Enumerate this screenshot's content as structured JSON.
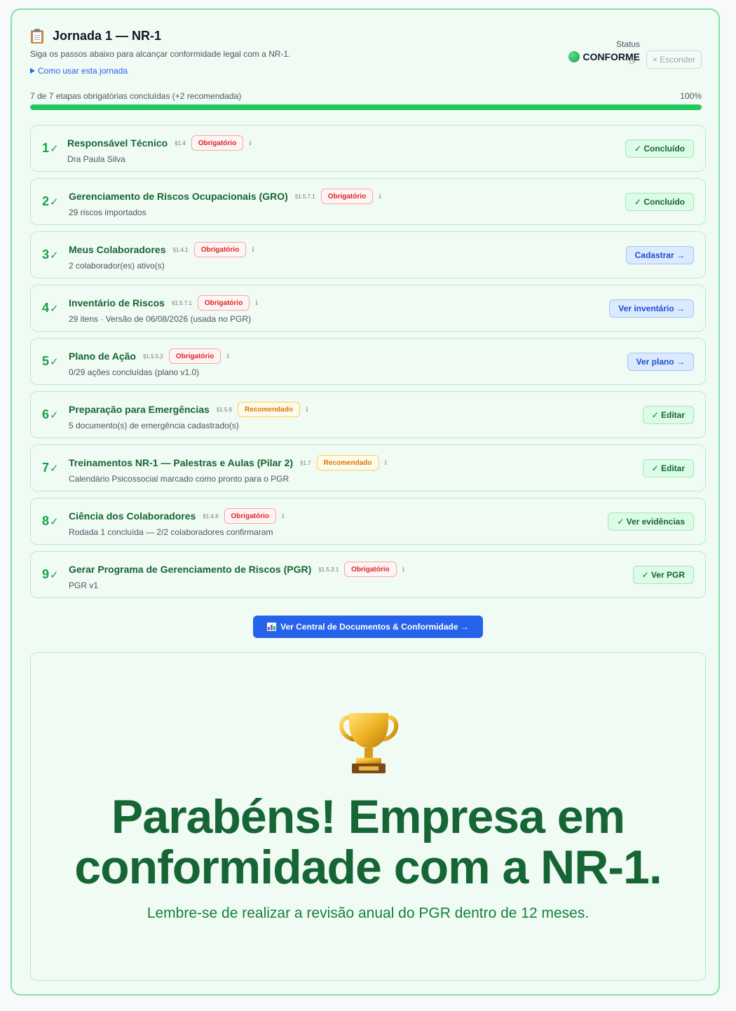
{
  "header": {
    "icon": "clipboard-icon",
    "title": "Jornada 1 — NR-1",
    "subtitle": "Siga os passos abaixo para alcançar conformidade legal com a NR-1.",
    "howto_label": "Como usar esta jornada",
    "status_label": "Status",
    "status_value": "CONFORME",
    "status_color": "#1a9c49",
    "refresh_icon": "refresh-icon",
    "hide_label": "× Esconder"
  },
  "progress": {
    "text": "7 de 7 etapas obrigatórias concluídas (+2 recomendada)",
    "percent_label": "100%",
    "percent": 100
  },
  "steps": [
    {
      "num": "1",
      "name": "Responsável Técnico",
      "section": "§1.4",
      "tag": "Obrigatório",
      "tag_type": "req",
      "desc": "Dra Paula Silva",
      "action": "✓ Concluído",
      "action_type": "done"
    },
    {
      "num": "2",
      "name": "Gerenciamento de Riscos Ocupacionais (GRO)",
      "section": "§1.5.7.1",
      "tag": "Obrigatório",
      "tag_type": "req",
      "desc": "29 riscos importados",
      "action": "✓ Concluído",
      "action_type": "done"
    },
    {
      "num": "3",
      "name": "Meus Colaboradores",
      "section": "§1.4.1",
      "tag": "Obrigatório",
      "tag_type": "req",
      "desc": "2 colaborador(es) ativo(s)",
      "action": "Cadastrar →",
      "action_type": "go"
    },
    {
      "num": "4",
      "name": "Inventário de Riscos",
      "section": "§1.5.7.1",
      "tag": "Obrigatório",
      "tag_type": "req",
      "desc": "29 itens · Versão de 06/08/2026 (usada no PGR)",
      "action": "Ver inventário →",
      "action_type": "go"
    },
    {
      "num": "5",
      "name": "Plano de Ação",
      "section": "§1.5.5.2",
      "tag": "Obrigatório",
      "tag_type": "req",
      "desc": "0/29 ações concluídas (plano v1.0)",
      "action": "Ver plano →",
      "action_type": "go"
    },
    {
      "num": "6",
      "name": "Preparação para Emergências",
      "section": "§1.5.6",
      "tag": "Recomendado",
      "tag_type": "rec",
      "desc": "5 documento(s) de emergência cadastrado(s)",
      "action": "✓ Editar",
      "action_type": "done"
    },
    {
      "num": "7",
      "name": "Treinamentos NR-1 — Palestras e Aulas (Pilar 2)",
      "section": "§1.7",
      "tag": "Recomendado",
      "tag_type": "rec",
      "desc": "Calendário Psicossocial marcado como pronto para o PGR",
      "action": "✓ Editar",
      "action_type": "done"
    },
    {
      "num": "8",
      "name": "Ciência dos Colaboradores",
      "section": "§1.4.6",
      "tag": "Obrigatório",
      "tag_type": "req",
      "desc": "Rodada 1 concluída — 2/2 colaboradores confirmaram",
      "action": "✓ Ver evidências",
      "action_type": "done"
    },
    {
      "num": "9",
      "name": "Gerar Programa de Gerenciamento de Riscos (PGR)",
      "section": "§1.5.3.1",
      "tag": "Obrigatório",
      "tag_type": "req",
      "desc": "PGR v1",
      "action": "✓ Ver PGR",
      "action_type": "done"
    }
  ],
  "central_button": {
    "icon": "bar-chart-icon",
    "label": "Ver Central de Documentos & Conformidade →"
  },
  "congrats": {
    "icon": "trophy-icon",
    "title": "Parabéns! Empresa em conformidade com a NR-1.",
    "subtitle": "Lembre-se de realizar a revisão anual do PGR dentro de 12 meses."
  },
  "colors": {
    "accent": "#2563eb",
    "success": "#16a34a",
    "required": "#dc2626",
    "recommended": "#d97706"
  }
}
